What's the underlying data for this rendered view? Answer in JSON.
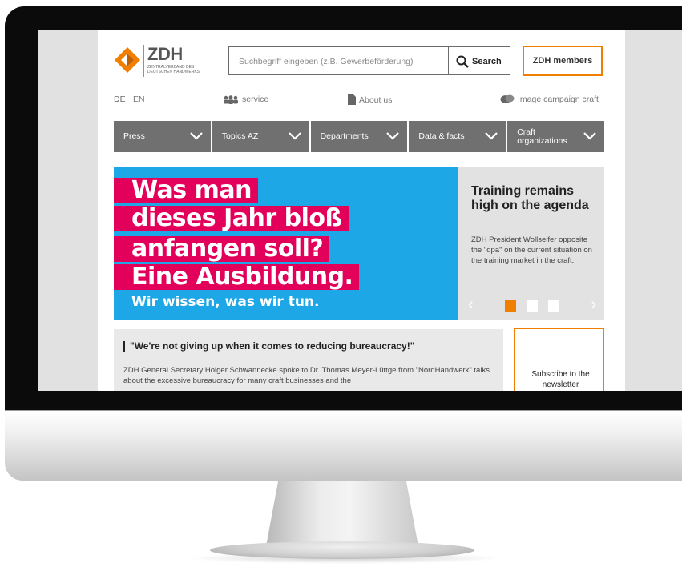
{
  "brand": {
    "name": "ZDH",
    "subtitle": "Zentralverband des Deutschen Handwerks",
    "accent_color": "#f07f00"
  },
  "search": {
    "placeholder": "Suchbegriff eingeben (z.B. Gewerbeförderung)",
    "button_label": "Search",
    "icon": "search-icon"
  },
  "members_button": "ZDH members",
  "utility": {
    "lang_de": "DE",
    "lang_en": "EN",
    "service": "service",
    "about": "About us",
    "campaign": "Image campaign craft"
  },
  "nav": {
    "items": [
      {
        "label": "Press"
      },
      {
        "label": "Topics AZ"
      },
      {
        "label": "Departments"
      },
      {
        "label": "Data & facts"
      },
      {
        "label": "Craft organizations"
      }
    ]
  },
  "hero": {
    "lines": [
      "Was man",
      "dieses Jahr bloß",
      "anfangen soll?",
      "Eine Ausbildung."
    ],
    "tagline": "Wir wissen, was wir tun.",
    "title": "Training remains high on the agenda",
    "text": "ZDH President Wollseifer opposite the \"dpa\" on the current situation on the training market in the craft.",
    "slides_total": 3,
    "active_slide": 1,
    "colors": {
      "pink": "#e2005a",
      "blue": "#1ea7e6"
    }
  },
  "teaser": {
    "title": "\"We're not giving up when it comes to reducing bureaucracy!\"",
    "text": "ZDH General Secretary Holger Schwannecke spoke to Dr. Thomas Meyer-Lüttge from \"NordHandwerk\" talks about the excessive bureaucracy for many craft businesses and the"
  },
  "newsletter": {
    "label": "Subscribe to the newsletter"
  }
}
